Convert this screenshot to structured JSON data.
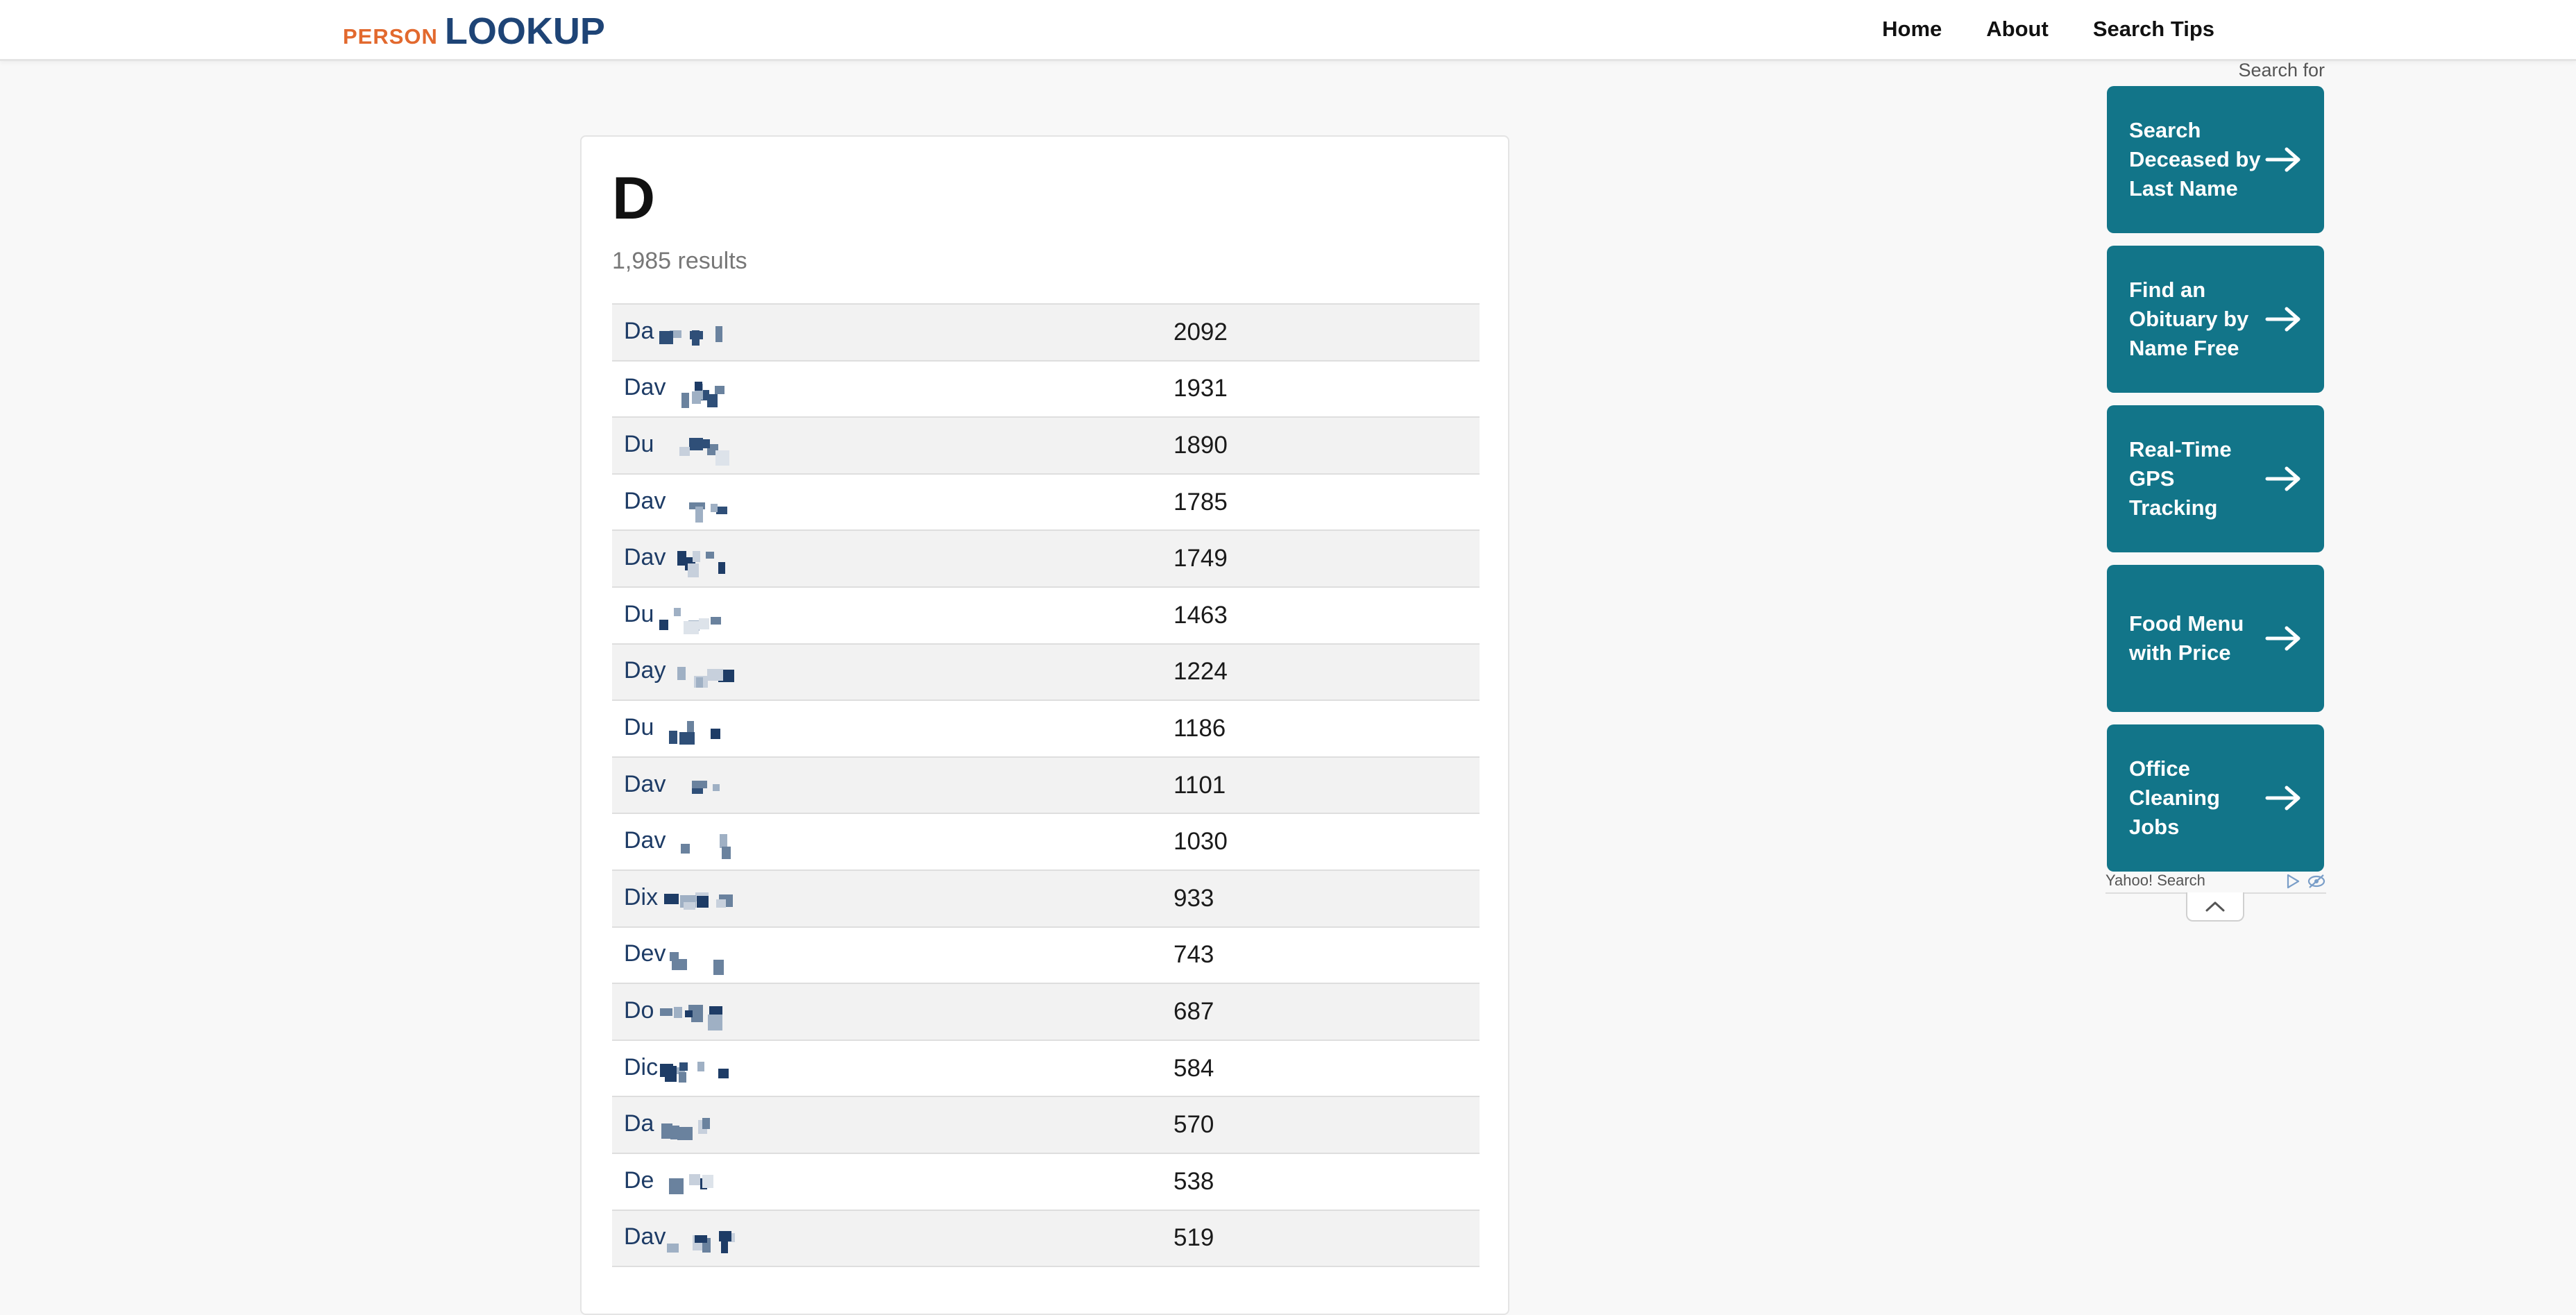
{
  "header": {
    "logo_person": "PERSON",
    "logo_lookup": "LOOKUP",
    "nav": [
      {
        "label": "Home"
      },
      {
        "label": "About"
      },
      {
        "label": "Search Tips"
      }
    ]
  },
  "main": {
    "title": "D",
    "results_count": "1,985 results",
    "rows": [
      {
        "name": "Da",
        "count": "2092"
      },
      {
        "name": "Dav",
        "count": "1931"
      },
      {
        "name": "Du",
        "count": "1890"
      },
      {
        "name": "Dav",
        "count": "1785"
      },
      {
        "name": "Dav",
        "count": "1749"
      },
      {
        "name": "Du",
        "count": "1463"
      },
      {
        "name": "Day",
        "count": "1224"
      },
      {
        "name": "Du",
        "count": "1186"
      },
      {
        "name": "Dav",
        "count": "1101"
      },
      {
        "name": "Dav",
        "count": "1030"
      },
      {
        "name": "Dix",
        "count": "933"
      },
      {
        "name": "Dev",
        "count": "743"
      },
      {
        "name": "Do",
        "count": "687"
      },
      {
        "name": "Dic",
        "count": "584"
      },
      {
        "name": "Da",
        "count": "570"
      },
      {
        "name": "De",
        "count": "538"
      },
      {
        "name": "Dav",
        "count": "519"
      }
    ]
  },
  "ads": {
    "search_for": "Search for",
    "tiles": [
      {
        "label": "Search Deceased by Last Name"
      },
      {
        "label": "Find an Obituary by Name Free"
      },
      {
        "label": "Real-Time GPS Tracking"
      },
      {
        "label": "Food Menu with Price"
      },
      {
        "label": "Office Cleaning Jobs"
      }
    ],
    "footer_brand": "Yahoo! Search",
    "colors": {
      "tile_bg": "#127589",
      "logo_orange": "#e2692e",
      "logo_blue": "#1e4476"
    }
  }
}
